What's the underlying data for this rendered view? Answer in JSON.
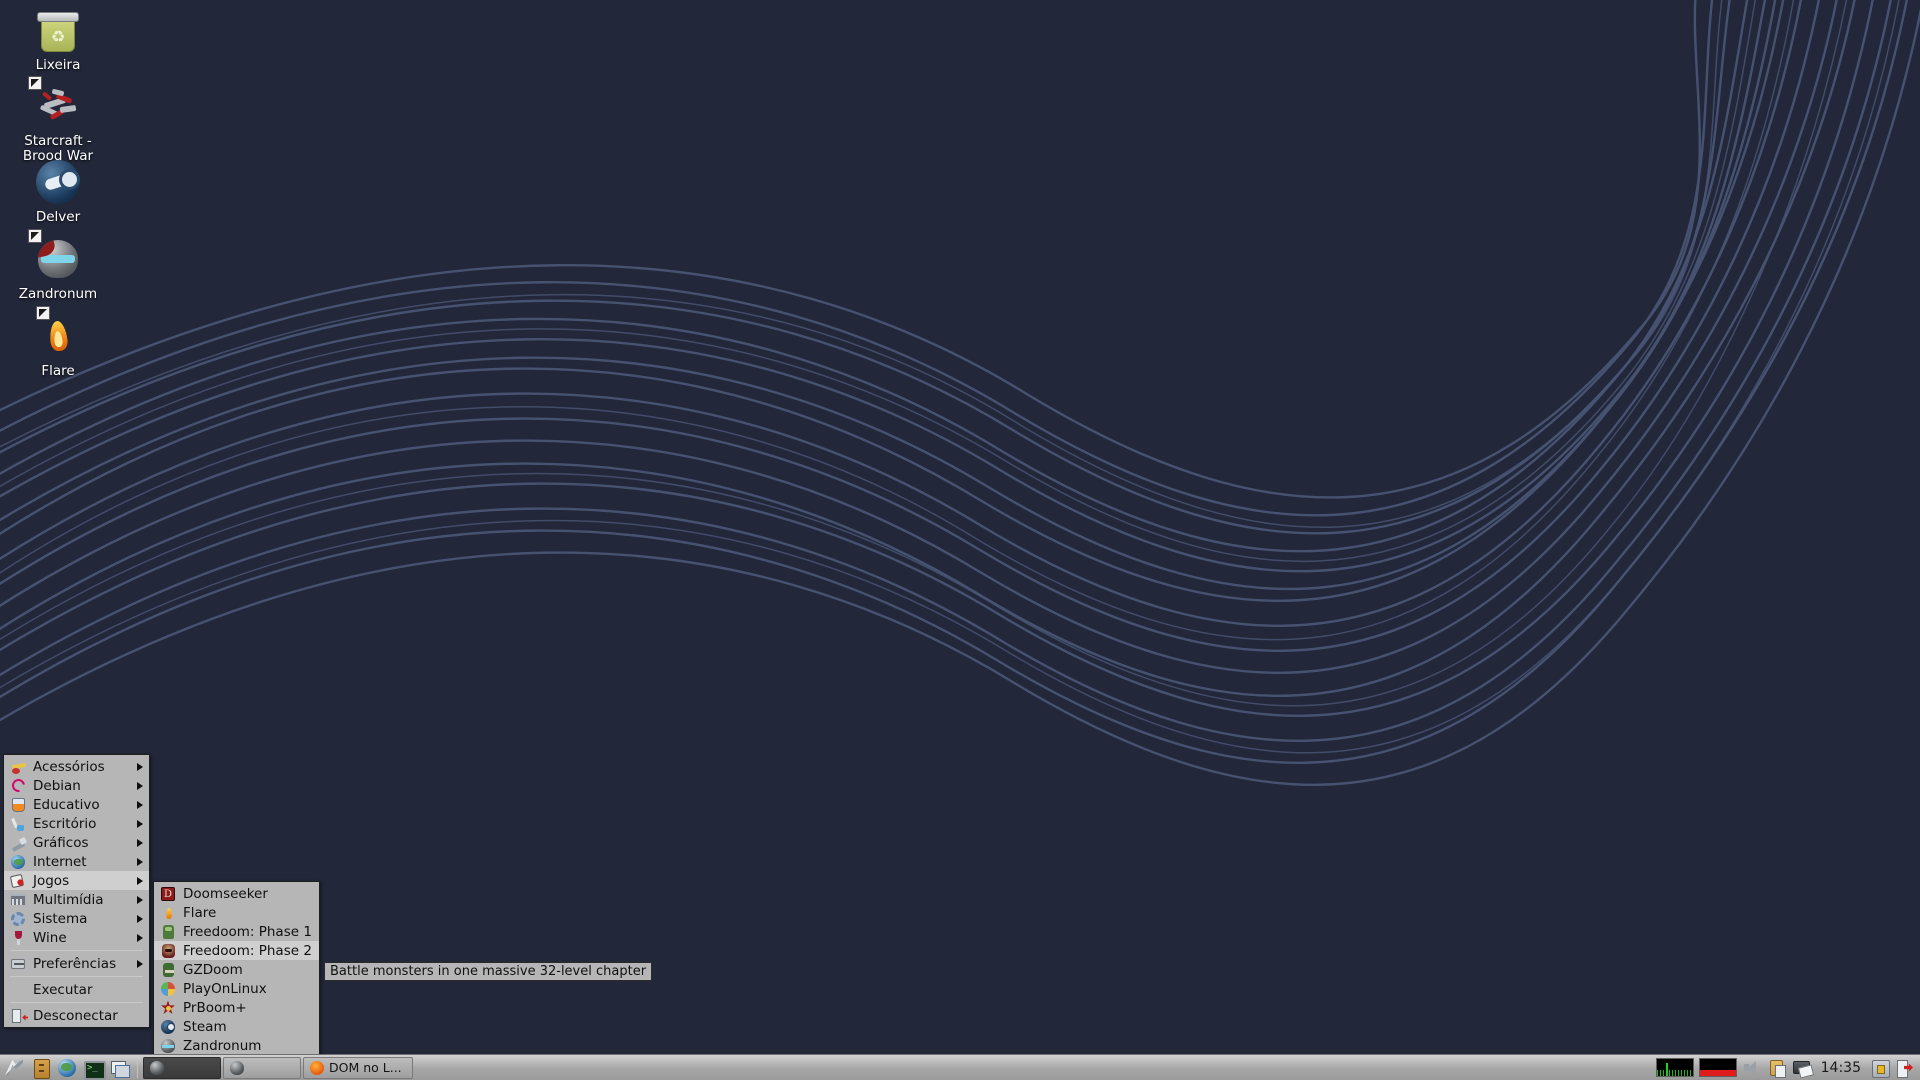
{
  "desktop": {
    "background_color": "#222739",
    "wave_color": "#4a5575",
    "icons": [
      {
        "label": "Lixeira",
        "icon": "trash-icon",
        "is_link": false
      },
      {
        "label": "Starcraft - Brood War",
        "icon": "starcraft-icon",
        "is_link": true
      },
      {
        "label": "Delver",
        "icon": "steam-icon",
        "is_link": false
      },
      {
        "label": "Zandronum",
        "icon": "zandronum-icon",
        "is_link": true
      },
      {
        "label": "Flare",
        "icon": "flare-icon",
        "is_link": true
      }
    ]
  },
  "app_menu": {
    "items": [
      {
        "label": "Acessórios",
        "icon": "scissors-icon",
        "submenu": true,
        "selected": false
      },
      {
        "label": "Debian",
        "icon": "debian-icon",
        "submenu": true,
        "selected": false
      },
      {
        "label": "Educativo",
        "icon": "flask-icon",
        "submenu": true,
        "selected": false
      },
      {
        "label": "Escritório",
        "icon": "brush-icon",
        "submenu": true,
        "selected": false
      },
      {
        "label": "Gráficos",
        "icon": "pencil-icon",
        "submenu": true,
        "selected": false
      },
      {
        "label": "Internet",
        "icon": "globe-icon",
        "submenu": true,
        "selected": false
      },
      {
        "label": "Jogos",
        "icon": "cards-icon",
        "submenu": true,
        "selected": true
      },
      {
        "label": "Multimídia",
        "icon": "film-icon",
        "submenu": true,
        "selected": false
      },
      {
        "label": "Sistema",
        "icon": "gear-icon",
        "submenu": true,
        "selected": false
      },
      {
        "label": "Wine",
        "icon": "wine-glass-icon",
        "submenu": true,
        "selected": false
      },
      {
        "label": "Preferências",
        "icon": "preferences-icon",
        "submenu": true,
        "selected": false
      },
      {
        "label": "Executar",
        "icon": "",
        "submenu": false,
        "selected": false
      },
      {
        "label": "Desconectar",
        "icon": "logout-icon",
        "submenu": false,
        "selected": false
      }
    ]
  },
  "games_submenu": {
    "items": [
      {
        "label": "Doomseeker",
        "icon": "doomseeker-icon",
        "selected": false
      },
      {
        "label": "Flare",
        "icon": "flare-small-icon",
        "selected": false
      },
      {
        "label": "Freedoom: Phase 1",
        "icon": "freedoom1-icon",
        "selected": false
      },
      {
        "label": "Freedoom: Phase 2",
        "icon": "freedoom2-icon",
        "selected": true
      },
      {
        "label": "GZDoom",
        "icon": "gzdoom-icon",
        "selected": false
      },
      {
        "label": "PlayOnLinux",
        "icon": "playonlinux-icon",
        "selected": false
      },
      {
        "label": "PrBoom+",
        "icon": "prboom-icon",
        "selected": false
      },
      {
        "label": "Steam",
        "icon": "steam-small-icon",
        "selected": false
      },
      {
        "label": "Zandronum",
        "icon": "zandronum-small-icon",
        "selected": false
      }
    ]
  },
  "tooltip": {
    "text": "Battle monsters in one massive 32-level chapter"
  },
  "taskbar": {
    "launchers": [
      {
        "name": "xfce-menu-icon"
      },
      {
        "name": "file-manager-icon"
      },
      {
        "name": "web-browser-icon"
      },
      {
        "name": "terminal-icon"
      },
      {
        "name": "show-desktop-icon"
      }
    ],
    "windows": [
      {
        "label": "",
        "icon": "window-icon",
        "dark": true
      },
      {
        "label": "",
        "icon": "window-icon",
        "dark": false
      },
      {
        "label": "DOM no L...",
        "icon": "firefox-icon",
        "dark": false
      }
    ],
    "tray": [
      {
        "name": "cpu-monitor"
      },
      {
        "name": "network-monitor"
      },
      {
        "name": "volume-icon"
      },
      {
        "name": "clipboard-icon"
      },
      {
        "name": "screenshot-icon"
      }
    ],
    "clock": "14:35",
    "lock_icon": "lock-icon",
    "logout_icon": "logout-icon"
  }
}
